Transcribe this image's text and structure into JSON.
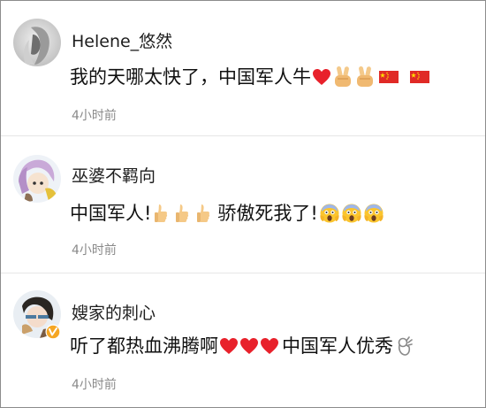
{
  "colors": {
    "heart": "#e8212b",
    "flag": "#e02a26",
    "flag_star": "#ffde00",
    "emoji_yellow": "#fbc52e",
    "verified_badge": "#f5a623",
    "username_text": "#1e1e1e",
    "time_text": "#8a8a8a"
  },
  "comments": [
    {
      "username": "Helene_悠然",
      "text_before": "我的天哪太快了，中国军人牛",
      "text_after": "",
      "emojis": [
        "heart",
        "victory-hand",
        "victory-hand",
        "china-flag",
        "china-flag"
      ],
      "time": "4小时前"
    },
    {
      "username": "巫婆不羁向",
      "text_before": "中国军人!",
      "text_middle": "骄傲死我了!",
      "emojis_thumbs": [
        "thumbs-up",
        "thumbs-up",
        "thumbs-up"
      ],
      "emojis_end": [
        "scream-face",
        "scream-face",
        "scream-face"
      ],
      "time": "4小时前"
    },
    {
      "username": "嫂家的刺心",
      "verified": true,
      "text_before": "听了都热血沸腾啊",
      "text_after": "中国军人优秀",
      "emojis_hearts": [
        "heart",
        "heart",
        "heart"
      ],
      "emojis_end": [
        "ok-hand"
      ],
      "time": "4小时前"
    }
  ]
}
